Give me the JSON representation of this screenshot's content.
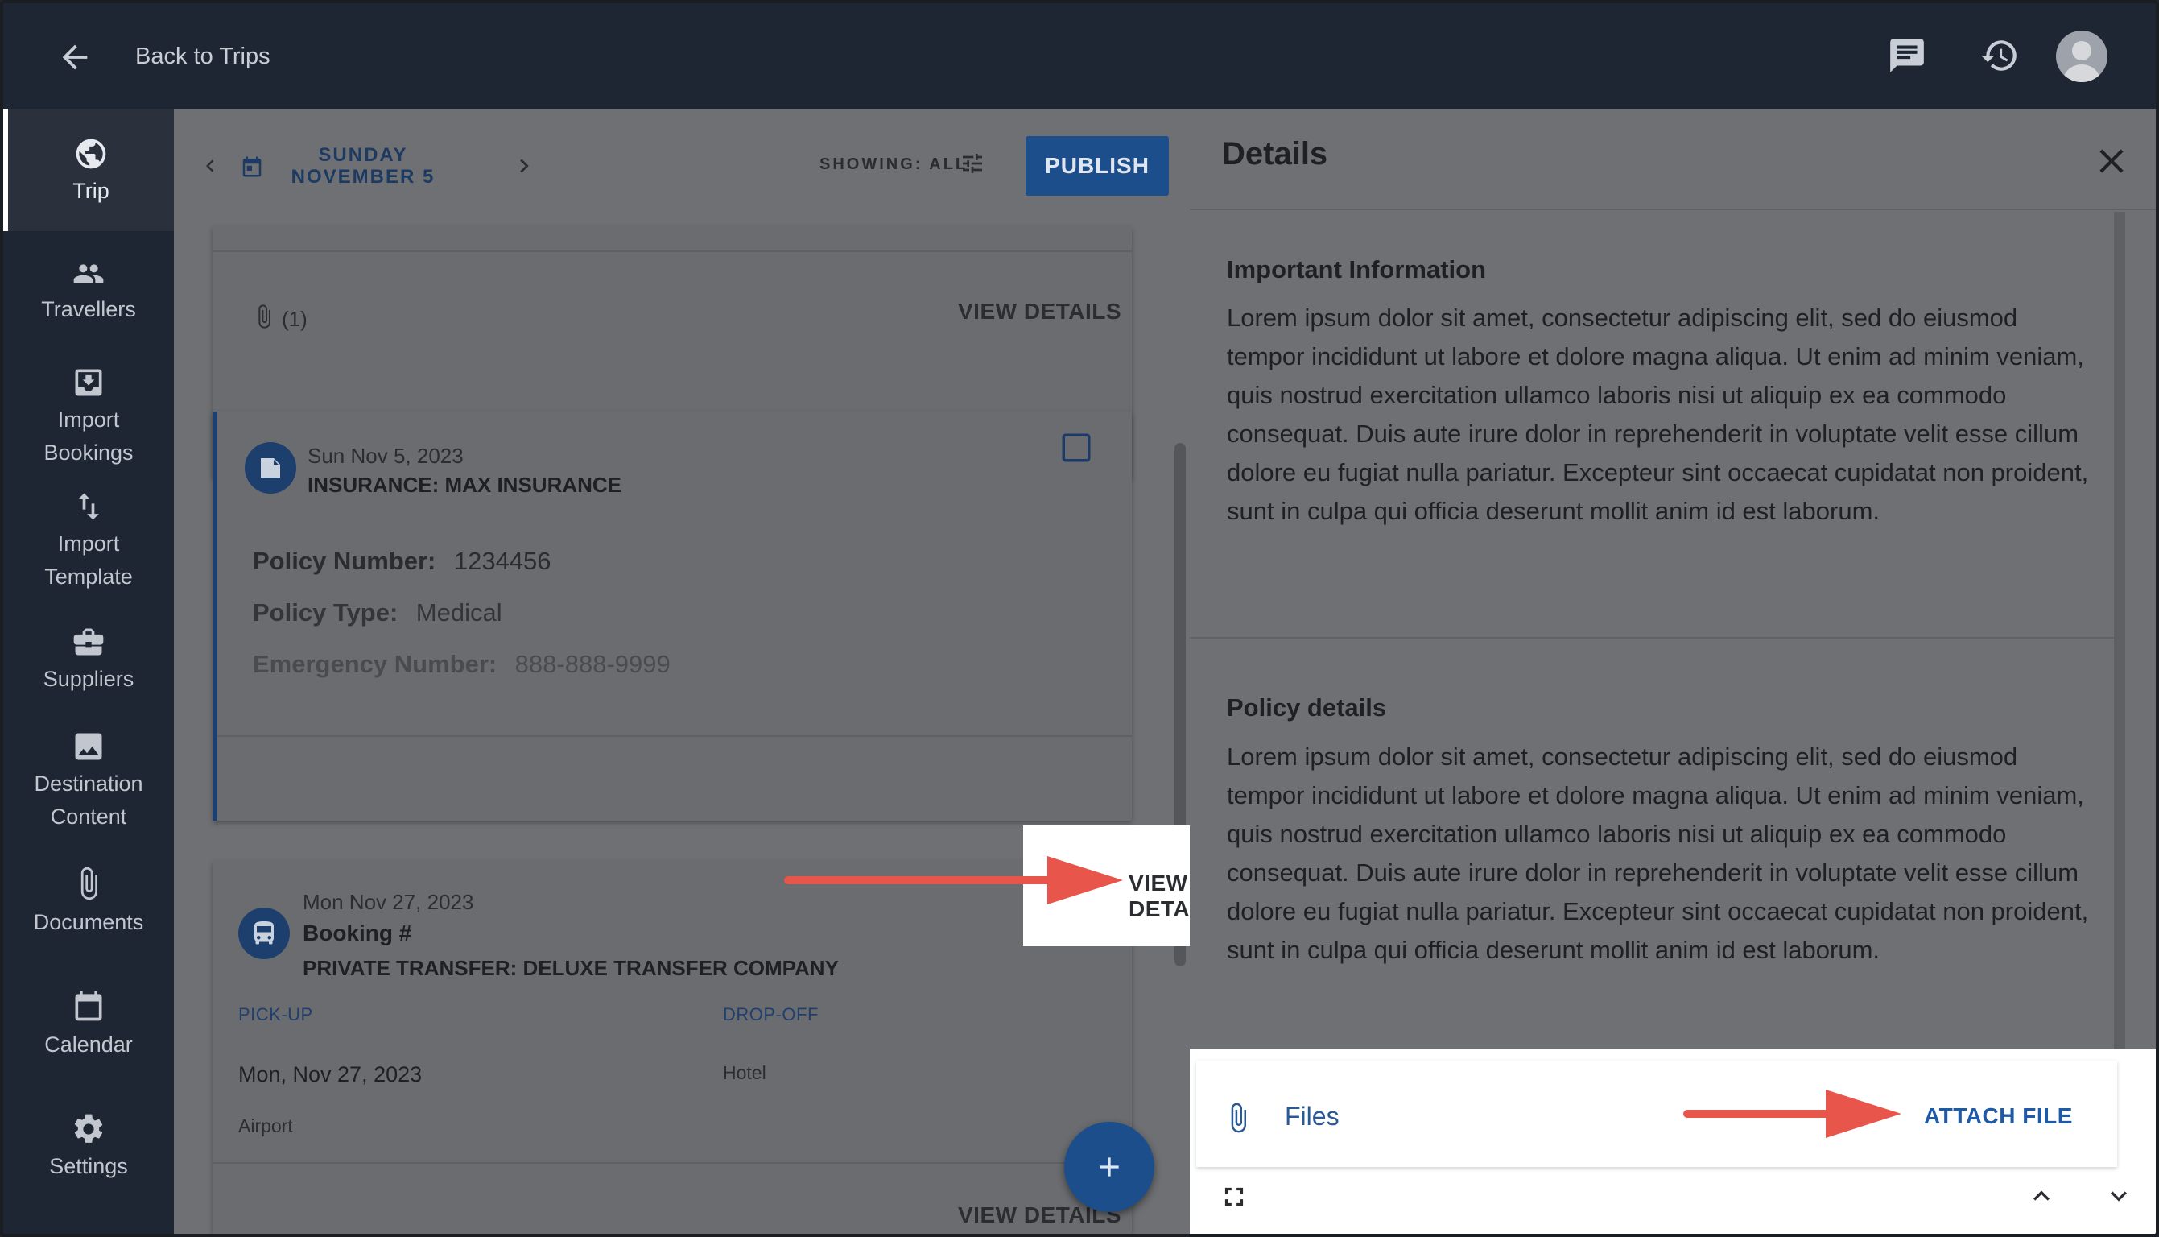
{
  "topbar": {
    "back_label": "Back to Trips",
    "icons": [
      "arrow-left-icon",
      "chat-icon",
      "history-icon",
      "avatar"
    ]
  },
  "sidebar": {
    "items": [
      {
        "label": "Trip",
        "icon": "globe-icon",
        "active": true
      },
      {
        "label": "Travellers",
        "icon": "people-icon"
      },
      {
        "label": "Import Bookings",
        "icon": "import-icon"
      },
      {
        "label": "Import Template",
        "icon": "swap-vertical-icon"
      },
      {
        "label": "Suppliers",
        "icon": "briefcase-icon"
      },
      {
        "label": "Destination Content",
        "icon": "image-icon"
      },
      {
        "label": "Documents",
        "icon": "paperclip-icon"
      },
      {
        "label": "Calendar",
        "icon": "calendar-icon"
      },
      {
        "label": "Settings",
        "icon": "gear-icon"
      }
    ]
  },
  "middle": {
    "date_label": "SUNDAY NOVEMBER 5",
    "showing_label": "SHOWING: ALL",
    "publish_label": "PUBLISH",
    "top_card": {
      "attachments": "(1)",
      "view_details": "VIEW DETAILS"
    },
    "insurance_card": {
      "date": "Sun Nov 5, 2023",
      "title": "INSURANCE: MAX INSURANCE",
      "policy_number_label": "Policy Number:",
      "policy_number": "1234456",
      "policy_type_label": "Policy Type:",
      "policy_type": "Medical",
      "emergency_label": "Emergency Number:",
      "emergency_number": "888-888-9999",
      "view_details": "VIEW DETAILS"
    },
    "transfer_card": {
      "date": "Mon Nov 27, 2023",
      "booking": "Booking #",
      "title": "PRIVATE TRANSFER: DELUXE TRANSFER COMPANY",
      "pickup_label": "PICK-UP",
      "dropoff_label": "DROP-OFF",
      "pickup_date": "Mon, Nov 27, 2023",
      "dropoff_value": "Hotel",
      "pickup_place": "Airport",
      "view_details": "VIEW DETAILS"
    }
  },
  "details": {
    "title": "Details",
    "important_title": "Important Information",
    "important_text": "Lorem ipsum dolor sit amet, consectetur adipiscing elit, sed do eiusmod tempor incididunt ut labore et dolore magna aliqua. Ut enim ad minim veniam, quis nostrud exercitation ullamco laboris nisi ut aliquip ex ea commodo consequat. Duis aute irure dolor in reprehenderit in voluptate velit esse cillum dolore eu fugiat nulla pariatur. Excepteur sint occaecat cupidatat non proident, sunt in culpa qui officia deserunt mollit anim id est laborum.",
    "policy_title": "Policy details",
    "policy_text": "Lorem ipsum dolor sit amet, consectetur adipiscing elit, sed do eiusmod tempor incididunt ut labore et dolore magna aliqua. Ut enim ad minim veniam, quis nostrud exercitation ullamco laboris nisi ut aliquip ex ea commodo consequat. Duis aute irure dolor in reprehenderit in voluptate velit esse cillum dolore eu fugiat nulla pariatur. Excepteur sint occaecat cupidatat non proident, sunt in culpa qui officia deserunt mollit anim id est laborum.",
    "files_label": "Files",
    "attach_label": "ATTACH FILE"
  },
  "colors": {
    "accent": "#1c4e8c",
    "annotation_arrow": "#e8554a",
    "dark_bar": "#1f2633"
  }
}
